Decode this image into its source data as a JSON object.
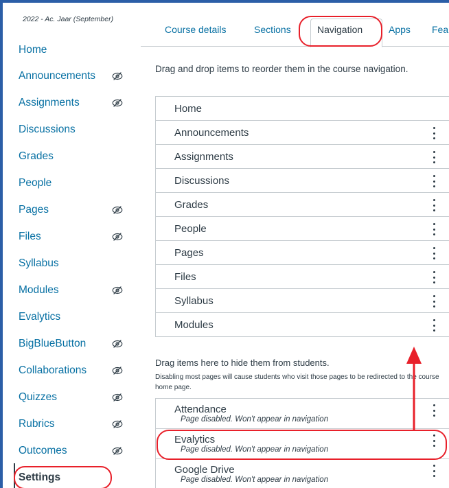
{
  "sidebar": {
    "term": "2022 - Ac. Jaar (September)",
    "items": [
      {
        "label": "Home",
        "hidden": false
      },
      {
        "label": "Announcements",
        "hidden": true
      },
      {
        "label": "Assignments",
        "hidden": true
      },
      {
        "label": "Discussions",
        "hidden": false
      },
      {
        "label": "Grades",
        "hidden": false
      },
      {
        "label": "People",
        "hidden": false
      },
      {
        "label": "Pages",
        "hidden": true
      },
      {
        "label": "Files",
        "hidden": true
      },
      {
        "label": "Syllabus",
        "hidden": false
      },
      {
        "label": "Modules",
        "hidden": true
      },
      {
        "label": "Evalytics",
        "hidden": false
      },
      {
        "label": "BigBlueButton",
        "hidden": true
      },
      {
        "label": "Collaborations",
        "hidden": true
      },
      {
        "label": "Quizzes",
        "hidden": true
      },
      {
        "label": "Rubrics",
        "hidden": true
      },
      {
        "label": "Outcomes",
        "hidden": true
      },
      {
        "label": "Settings",
        "hidden": false
      }
    ]
  },
  "tabs": [
    {
      "label": "Course details"
    },
    {
      "label": "Sections"
    },
    {
      "label": "Navigation"
    },
    {
      "label": "Apps"
    },
    {
      "label": "Fea"
    }
  ],
  "instructions": "Drag and drop items to reorder them in the course navigation.",
  "visible_items": [
    "Home",
    "Announcements",
    "Assignments",
    "Discussions",
    "Grades",
    "People",
    "Pages",
    "Files",
    "Syllabus",
    "Modules"
  ],
  "hide_section": {
    "title": "Drag items here to hide them from students.",
    "note": "Disabling most pages will cause students who visit those pages to be redirected to the course home page."
  },
  "hidden_items": [
    {
      "label": "Attendance",
      "status": "Page disabled. Won't appear in navigation"
    },
    {
      "label": "Evalytics",
      "status": "Page disabled. Won't appear in navigation"
    },
    {
      "label": "Google Drive",
      "status": "Page disabled. Won't appear in navigation"
    }
  ],
  "colors": {
    "link": "#0770a3",
    "text": "#2d3b45",
    "border": "#c7cdd1",
    "annotation": "#e8202a",
    "brand": "#2b5ea7"
  }
}
